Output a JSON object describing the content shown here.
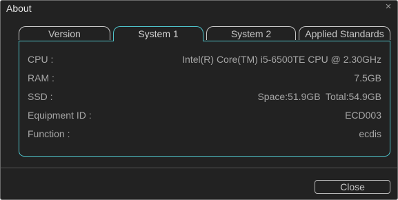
{
  "window": {
    "title": "About",
    "close_icon_glyph": "×"
  },
  "tabs": [
    {
      "label": "Version",
      "active": false
    },
    {
      "label": "System 1",
      "active": true
    },
    {
      "label": "System 2",
      "active": false
    },
    {
      "label": "Applied Standards",
      "active": false
    }
  ],
  "system_info": [
    {
      "label": "CPU :",
      "value": "Intel(R) Core(TM) i5-6500TE CPU @ 2.30GHz"
    },
    {
      "label": "RAM :",
      "value": "7.5GB"
    },
    {
      "label": "SSD :",
      "value": "Space:51.9GB  Total:54.9GB"
    },
    {
      "label": "Equipment ID :",
      "value": "ECD003"
    },
    {
      "label": "Function :",
      "value": "ecdis"
    }
  ],
  "footer": {
    "close_label": "Close"
  },
  "colors": {
    "background": "#222222",
    "accent": "#4fc3ca",
    "text": "#a6a6a6"
  }
}
